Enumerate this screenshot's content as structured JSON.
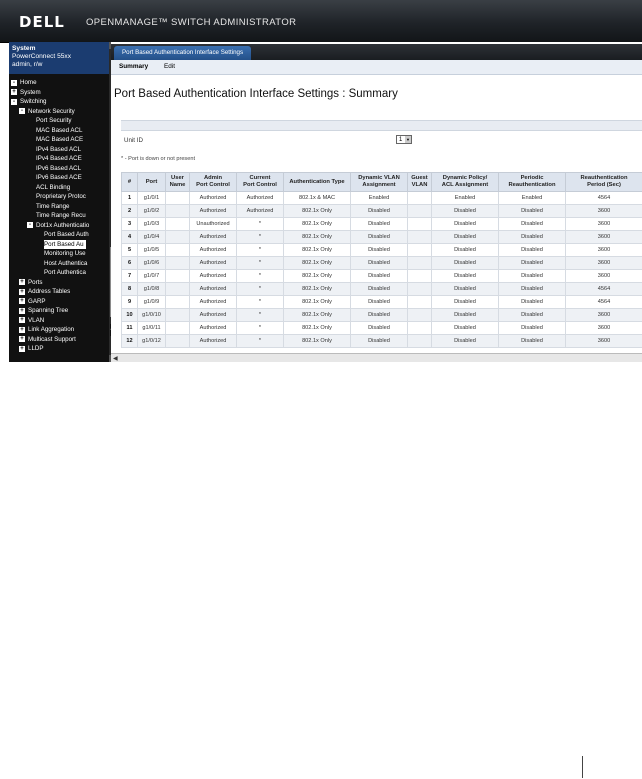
{
  "header": {
    "logo": "DELL",
    "title": "OPENMANAGE™ SWITCH ADMINISTRATOR"
  },
  "system": {
    "name": "System",
    "model": "PowerConnect 55xx",
    "user": "admin, r/w"
  },
  "tree": [
    {
      "label": "Home",
      "level": 0,
      "toggle": "-"
    },
    {
      "label": "System",
      "level": 0,
      "toggle": "+"
    },
    {
      "label": "Switching",
      "level": 0,
      "toggle": "-"
    },
    {
      "label": "Network Security",
      "level": 1,
      "toggle": "-"
    },
    {
      "label": "Port Security",
      "level": 2
    },
    {
      "label": "MAC Based ACL",
      "level": 2
    },
    {
      "label": "MAC Based ACE",
      "level": 2
    },
    {
      "label": "IPv4 Based ACL",
      "level": 2
    },
    {
      "label": "IPv4 Based ACE",
      "level": 2
    },
    {
      "label": "IPv6 Based ACL",
      "level": 2
    },
    {
      "label": "IPv6 Based ACE",
      "level": 2
    },
    {
      "label": "ACL Binding",
      "level": 2
    },
    {
      "label": "Proprietary Protoc",
      "level": 2
    },
    {
      "label": "Time Range",
      "level": 2
    },
    {
      "label": "Time Range Recu",
      "level": 2
    },
    {
      "label": "Dot1x Authenticatio",
      "level": 2,
      "toggle": "-"
    },
    {
      "label": "Port Based Auth",
      "level": 3
    },
    {
      "label": "Port Based Au",
      "level": 3,
      "selected": true
    },
    {
      "label": "Monitoring Use",
      "level": 3
    },
    {
      "label": "Host Authentica",
      "level": 3
    },
    {
      "label": "Port Authentica",
      "level": 3
    },
    {
      "label": "Ports",
      "level": 1,
      "toggle": "+"
    },
    {
      "label": "Address Tables",
      "level": 1,
      "toggle": "+"
    },
    {
      "label": "GARP",
      "level": 1,
      "toggle": "+"
    },
    {
      "label": "Spanning Tree",
      "level": 1,
      "toggle": "+"
    },
    {
      "label": "VLAN",
      "level": 1,
      "toggle": "+"
    },
    {
      "label": "Link Aggregation",
      "level": 1,
      "toggle": "+"
    },
    {
      "label": "Multicast Support",
      "level": 1,
      "toggle": "+"
    },
    {
      "label": "LLDP",
      "level": 1,
      "toggle": "+"
    }
  ],
  "main": {
    "tab": "Port Based Authentication Interface Settings",
    "subtabs": [
      "Summary",
      "Edit"
    ],
    "page_title": "Port Based Authentication Interface Settings : Summary",
    "unit_label": "Unit ID",
    "unit_value": "1",
    "note": "* - Port is down or not present",
    "columns": [
      "#",
      "Port",
      "User\nName",
      "Admin\nPort Control",
      "Current\nPort Control",
      "Authentication Type",
      "Dynamic VLAN\nAssignment",
      "Guest\nVLAN",
      "Dynamic Policy/\nACL Assignment",
      "Periodic\nReauthentication",
      "Reauthentication\nPeriod (Sec)"
    ],
    "rows": [
      [
        "1",
        "g1/0/1",
        "",
        "Authorized",
        "Authorized",
        "802.1x & MAC",
        "Enabled",
        "",
        "Enabled",
        "Enabled",
        "4564"
      ],
      [
        "2",
        "g1/0/2",
        "",
        "Authorized",
        "Authorized",
        "802.1x Only",
        "Disabled",
        "",
        "Disabled",
        "Disabled",
        "3600"
      ],
      [
        "3",
        "g1/0/3",
        "",
        "Unauthorized",
        "*",
        "802.1x Only",
        "Disabled",
        "",
        "Disabled",
        "Disabled",
        "3600"
      ],
      [
        "4",
        "g1/0/4",
        "",
        "Authorized",
        "*",
        "802.1x Only",
        "Disabled",
        "",
        "Disabled",
        "Disabled",
        "3600"
      ],
      [
        "5",
        "g1/0/5",
        "",
        "Authorized",
        "*",
        "802.1x Only",
        "Disabled",
        "",
        "Disabled",
        "Disabled",
        "3600"
      ],
      [
        "6",
        "g1/0/6",
        "",
        "Authorized",
        "*",
        "802.1x Only",
        "Disabled",
        "",
        "Disabled",
        "Disabled",
        "3600"
      ],
      [
        "7",
        "g1/0/7",
        "",
        "Authorized",
        "*",
        "802.1x Only",
        "Disabled",
        "",
        "Disabled",
        "Disabled",
        "3600"
      ],
      [
        "8",
        "g1/0/8",
        "",
        "Authorized",
        "*",
        "802.1x Only",
        "Disabled",
        "",
        "Disabled",
        "Disabled",
        "4564"
      ],
      [
        "9",
        "g1/0/9",
        "",
        "Authorized",
        "*",
        "802.1x Only",
        "Disabled",
        "",
        "Disabled",
        "Disabled",
        "4564"
      ],
      [
        "10",
        "g1/0/10",
        "",
        "Authorized",
        "*",
        "802.1x Only",
        "Disabled",
        "",
        "Disabled",
        "Disabled",
        "3600"
      ],
      [
        "11",
        "g1/0/11",
        "",
        "Authorized",
        "*",
        "802.1x Only",
        "Disabled",
        "",
        "Disabled",
        "Disabled",
        "3600"
      ],
      [
        "12",
        "g1/0/12",
        "",
        "Authorized",
        "*",
        "802.1x Only",
        "Disabled",
        "",
        "Disabled",
        "Disabled",
        "3600"
      ]
    ]
  },
  "colors": {
    "header": "#1f2328",
    "sidebar": "#111111",
    "tab": "#245089",
    "table_header": "#dde4ee"
  }
}
